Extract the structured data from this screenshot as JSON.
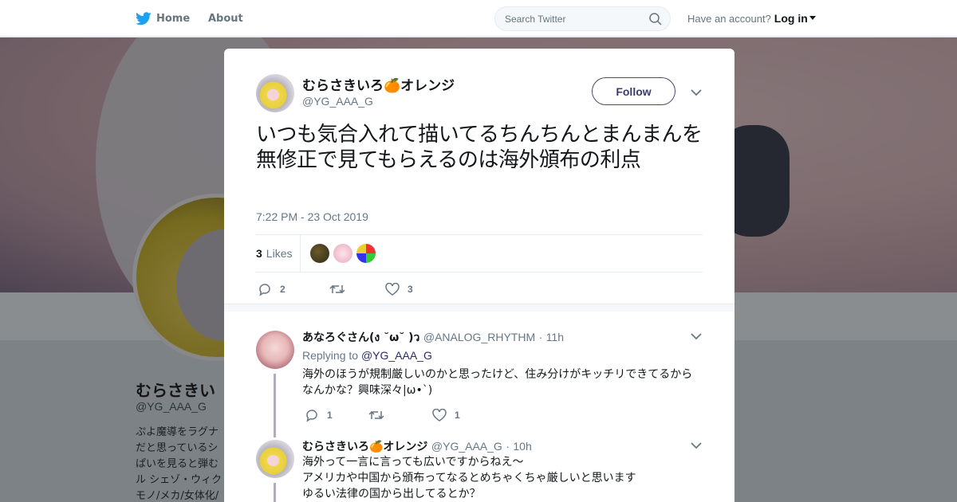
{
  "nav": {
    "home": "Home",
    "about": "About",
    "search_placeholder": "Search Twitter",
    "have_account": "Have an account?",
    "login": "Log in"
  },
  "profile": {
    "name": "むらさきい",
    "handle": "@YG_AAA_G",
    "bio": "ぷよ魔導をラグナ\nだと思っているシ\nぱいを見ると弾む\nル シェゾ・ウィク\nモノ/メカ/女体化/"
  },
  "tweet": {
    "author_name": "むらさきいろ🍊オレンジ",
    "author_handle": "@YG_AAA_G",
    "follow_label": "Follow",
    "text": "いつも気合入れて描いてるちんちんとまんまんを無修正で見てもらえるのは海外頒布の利点",
    "time": "7:22 PM - 23 Oct 2019",
    "likes_count": "3",
    "likes_label": "Likes",
    "actions": {
      "replies": "2",
      "retweets": "",
      "likes": "3"
    }
  },
  "replies": [
    {
      "name": "あなろぐさん(ง ˘ω˘ )ว",
      "handle": "@ANALOG_RHYTHM",
      "dot": "·",
      "age": "11h",
      "replying_to_label": "Replying to",
      "replying_to": "@YG_AAA_G",
      "text": "海外のほうが規制厳しいのかと思ったけど、住み分けがキッチリできてるからなんかな？興味深々|ω•`)",
      "actions": {
        "replies": "1",
        "retweets": "",
        "likes": "1"
      }
    },
    {
      "name": "むらさきいろ🍊オレンジ",
      "handle": "@YG_AAA_G",
      "dot": "·",
      "age": "10h",
      "lines": [
        "海外って一言に言っても広いですからねえ～",
        "アメリカや中国から頒布ってなるとめちゃくちゃ厳しいと思います",
        "ゆるい法律の国から出してるとか？"
      ]
    }
  ],
  "colors": {
    "twitter_blue": "#1da1f2",
    "follow_border": "#4a4a6a",
    "thread_line": "#b3a8cc",
    "orange_emoji": "#f58a1f"
  },
  "icons": [
    "twitter-bird-icon",
    "search-icon",
    "close-icon",
    "chevron-down-icon",
    "reply-icon",
    "retweet-icon",
    "heart-icon",
    "caret-down-icon"
  ]
}
